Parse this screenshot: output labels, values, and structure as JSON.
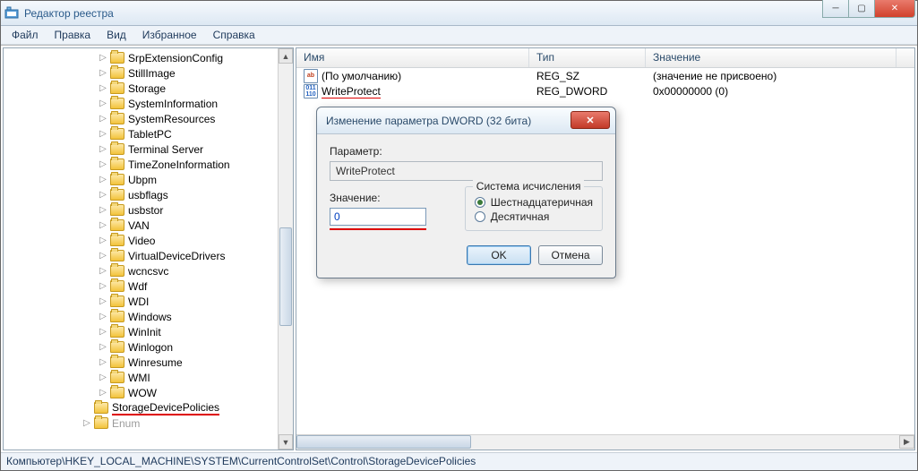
{
  "window": {
    "title": "Редактор реестра"
  },
  "menu": {
    "file": "Файл",
    "edit": "Правка",
    "view": "Вид",
    "favorites": "Избранное",
    "help": "Справка"
  },
  "tree": {
    "items": [
      "SrpExtensionConfig",
      "StillImage",
      "Storage",
      "SystemInformation",
      "SystemResources",
      "TabletPC",
      "Terminal Server",
      "TimeZoneInformation",
      "Ubpm",
      "usbflags",
      "usbstor",
      "VAN",
      "Video",
      "VirtualDeviceDrivers",
      "wcncsvc",
      "Wdf",
      "WDI",
      "Windows",
      "WinInit",
      "Winlogon",
      "Winresume",
      "WMI",
      "WOW"
    ],
    "selected": "StorageDevicePolicies",
    "trailing": "Enum"
  },
  "list": {
    "headers": {
      "name": "Имя",
      "type": "Тип",
      "value": "Значение"
    },
    "widths": {
      "name": 260,
      "type": 130,
      "value": 280
    },
    "rows": [
      {
        "icon": "sz",
        "name": "(По умолчанию)",
        "type": "REG_SZ",
        "value": "(значение не присвоено)"
      },
      {
        "icon": "dw",
        "name": "WriteProtect",
        "type": "REG_DWORD",
        "value": "0x00000000 (0)",
        "underline": true
      }
    ]
  },
  "dialog": {
    "title": "Изменение параметра DWORD (32 бита)",
    "param_label": "Параметр:",
    "param_value": "WriteProtect",
    "value_label": "Значение:",
    "value_input": "0",
    "base_group": "Система исчисления",
    "hex": "Шестнадцатеричная",
    "dec": "Десятичная",
    "ok": "OK",
    "cancel": "Отмена"
  },
  "status": "Компьютер\\HKEY_LOCAL_MACHINE\\SYSTEM\\CurrentControlSet\\Control\\StorageDevicePolicies"
}
